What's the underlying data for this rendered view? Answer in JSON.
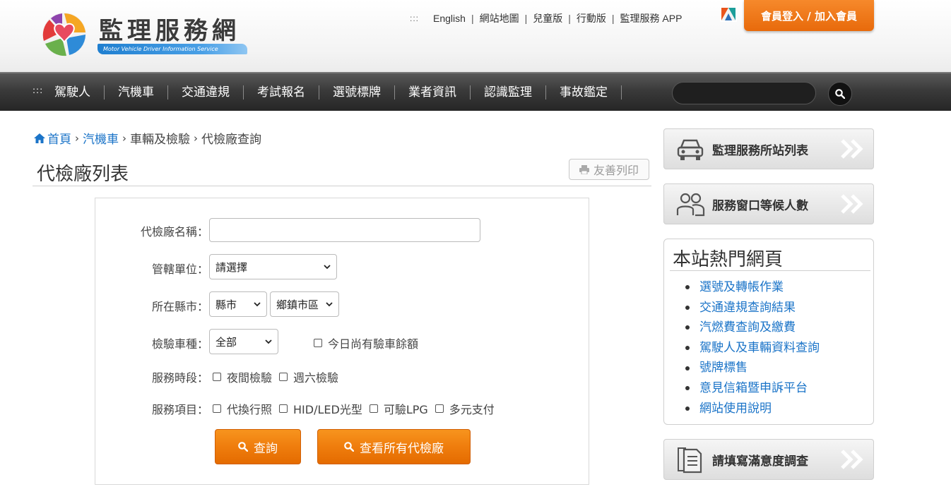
{
  "header": {
    "site_title": "監理服務網",
    "site_subtitle": "Motor Vehicle Driver Information Service",
    "toplinks_marker": ":::",
    "toplinks": [
      "English",
      "網站地圖",
      "兒童版",
      "行動版",
      "監理服務 APP"
    ],
    "login_label": "會員登入 / 加入會員"
  },
  "nav": {
    "marker": ":::",
    "items": [
      "駕駛人",
      "汽機車",
      "交通違規",
      "考試報名",
      "選號標牌",
      "業者資訊",
      "認識監理",
      "事故鑑定"
    ],
    "search_value": ""
  },
  "breadcrumb": [
    "首頁",
    "汽機車",
    "車輛及檢驗",
    "代檢廠查詢"
  ],
  "page": {
    "title": "代檢廠列表",
    "print_label": "友善列印"
  },
  "form": {
    "name_label": "代檢廠名稱：",
    "name_value": "",
    "unit_label": "管轄單位：",
    "unit_value": "請選擇",
    "county_label": "所在縣市：",
    "county_value": "縣市",
    "district_value": "鄉鎮市區",
    "vehicle_label": "檢驗車種：",
    "vehicle_value": "全部",
    "quota_label": "今日尚有驗車餘額",
    "hours_label": "服務時段：",
    "hours_options": [
      "夜間檢驗",
      "週六檢驗"
    ],
    "services_label": "服務項目：",
    "services_options": [
      "代換行照",
      "HID/LED光型",
      "可驗LPG",
      "多元支付"
    ],
    "search_button": "查詢",
    "all_button": "查看所有代檢廠"
  },
  "sidebar": {
    "banner1": "監理服務所站列表",
    "banner2": "服務窗口等候人數",
    "hot_title": "本站熱門網頁",
    "hot_links": [
      "選號及轉帳作業",
      "交通違規查詢結果",
      "汽燃費查詢及繳費",
      "駕駛人及車輛資料查詢",
      "號牌標售",
      "意見信箱暨申訴平台",
      "網站使用說明"
    ],
    "banner3": "請填寫滿意度調查"
  },
  "colors": {
    "accent_orange": "#ef7d0d",
    "link_blue": "#1b74c8",
    "nav_dark": "#2e2e2e"
  }
}
